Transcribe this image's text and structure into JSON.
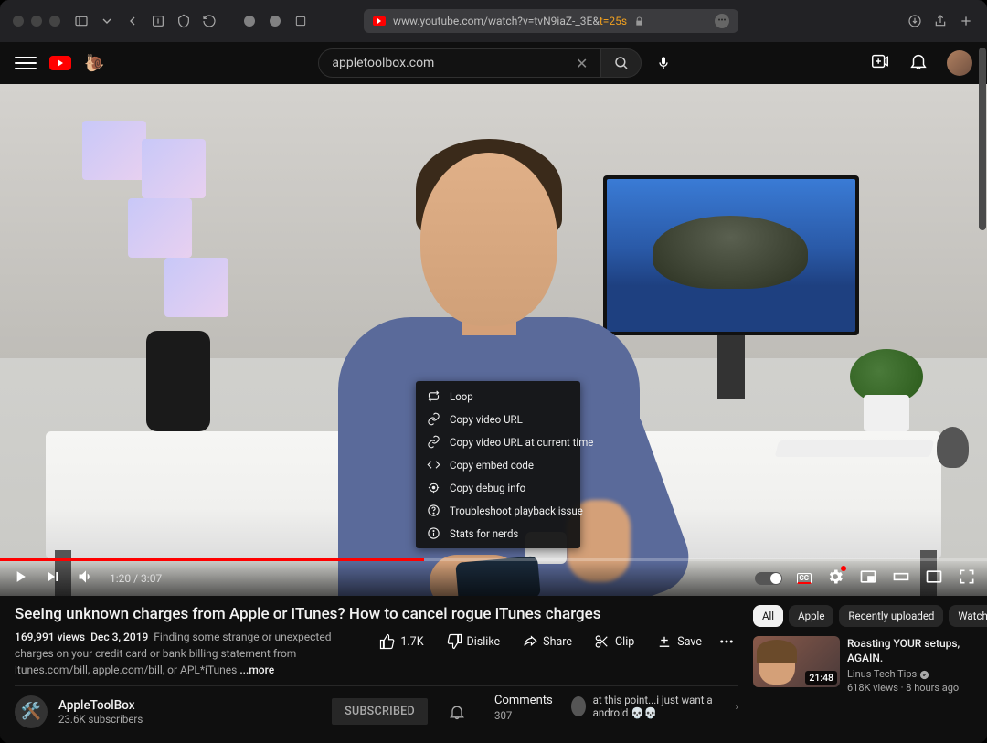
{
  "browser": {
    "url_prefix": "www.youtube.com/watch?v=tvN9iaZ-_3E&",
    "url_time": "t=25s"
  },
  "header": {
    "search_value": "appletoolbox.com"
  },
  "context_menu": {
    "items": [
      {
        "icon": "loop",
        "label": "Loop"
      },
      {
        "icon": "link",
        "label": "Copy video URL"
      },
      {
        "icon": "link",
        "label": "Copy video URL at current time"
      },
      {
        "icon": "embed",
        "label": "Copy embed code"
      },
      {
        "icon": "bug",
        "label": "Copy debug info"
      },
      {
        "icon": "help",
        "label": "Troubleshoot playback issue"
      },
      {
        "icon": "info",
        "label": "Stats for nerds"
      }
    ]
  },
  "player": {
    "time": "1:20 / 3:07",
    "cc": "CC"
  },
  "video": {
    "title": "Seeing unknown charges from Apple or iTunes? How to cancel rogue iTunes charges",
    "views": "169,991 views",
    "date": "Dec 3, 2019",
    "desc": "Finding some strange or unexpected charges on your credit card or bank billing statement from itunes.com/bill, apple.com/bill, or APL*iTunes",
    "more": "...more",
    "likes": "1.7K",
    "dislike": "Dislike",
    "share": "Share",
    "clip": "Clip",
    "save": "Save"
  },
  "channel": {
    "name": "AppleToolBox",
    "subs": "23.6K subscribers",
    "subscribe": "SUBSCRIBED"
  },
  "comments": {
    "label": "Comments",
    "count": "307",
    "top": "at this point...i just want a android 💀💀"
  },
  "chips": [
    "All",
    "Apple",
    "Recently uploaded",
    "Watched"
  ],
  "rec": {
    "title": "Roasting YOUR setups, AGAIN.",
    "channel": "Linus Tech Tips",
    "meta": "618K views · 8 hours ago",
    "duration": "21:48"
  }
}
